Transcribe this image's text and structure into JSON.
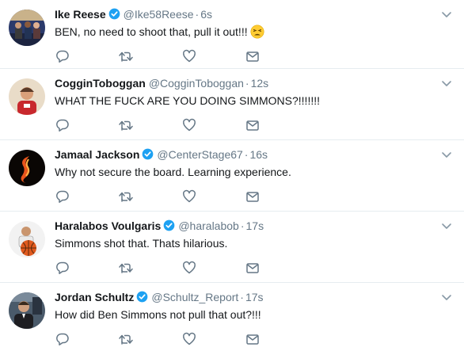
{
  "tweets": [
    {
      "name": "Ike Reese",
      "verified": true,
      "handle": "@Ike58Reese",
      "time": "6s",
      "text": "BEN, no need to shoot that, pull it out!!!",
      "emoji": "weary-face-emoji"
    },
    {
      "name": "CogginToboggan",
      "verified": false,
      "handle": "@CogginToboggan",
      "time": "12s",
      "text": "WHAT THE FUCK ARE YOU DOING SIMMONS?!!!!!!!"
    },
    {
      "name": "Jamaal Jackson",
      "verified": true,
      "handle": "@CenterStage67",
      "time": "16s",
      "text": "Why not secure the board. Learning experience."
    },
    {
      "name": "Haralabos Voulgaris",
      "verified": true,
      "handle": "@haralabob",
      "time": "17s",
      "text": "Simmons shot that. Thats hilarious."
    },
    {
      "name": "Jordan Schultz",
      "verified": true,
      "handle": "@Schultz_Report",
      "time": "17s",
      "text": "How did Ben Simmons not pull that out?!!!"
    }
  ],
  "separator": "·",
  "colors": {
    "verified_blue": "#1da1f2",
    "muted_text": "#657786",
    "icon_gray": "#657786",
    "divider": "#e6ecf0"
  },
  "icons": [
    "reply-icon",
    "retweet-icon",
    "like-icon",
    "direct-message-icon",
    "caret-down-icon",
    "verified-badge-icon"
  ]
}
